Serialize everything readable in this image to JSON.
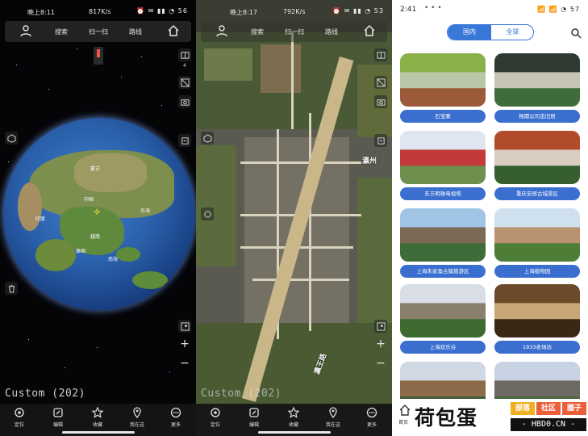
{
  "panel1": {
    "status": {
      "time": "晚上8:11",
      "net": "817K/s",
      "battery_icons": "⏰ ✉ ▮▮ ◔ 56"
    },
    "topbar": {
      "search": "搜索",
      "scan": "扫一扫",
      "route": "路线"
    },
    "side": {
      "layer_count": "4"
    },
    "custom_label": "Custom (202)",
    "globe_labels": [
      "蒙古",
      "中国",
      "东海",
      "南海",
      "越南",
      "泰国",
      "印度"
    ],
    "bottom": [
      "定位",
      "编辑",
      "收藏",
      "我在这",
      "更多"
    ]
  },
  "panel2": {
    "status": {
      "time": "晚上8:17",
      "net": "792K/s",
      "battery_icons": "⏰ ✉ ▮▮ ◔ 53"
    },
    "topbar": {
      "search": "搜索",
      "scan": "扫一扫",
      "route": "路线"
    },
    "custom_label": "Custom (202)",
    "road_labels": [
      "瀛州",
      "瀛王路"
    ],
    "bottom": [
      "定位",
      "编辑",
      "收藏",
      "我在这",
      "更多"
    ]
  },
  "panel3": {
    "status": {
      "time": "2:41",
      "dots": "• • •",
      "battery_icons": "📶 📶 ◔ 57"
    },
    "tabs": {
      "domestic": "国内",
      "global": "全球"
    },
    "cards": [
      {
        "caption": "石宝寨",
        "colors": [
          "#8ab04a",
          "#b7c7a8",
          "#9b5b3a"
        ]
      },
      {
        "caption": "杨闇公司志旧居",
        "colors": [
          "#2e3a32",
          "#c8c4b3",
          "#3f6d3a"
        ]
      },
      {
        "caption": "东方明珠电视塔",
        "colors": [
          "#dfe6ef",
          "#c43a3a",
          "#6e8f4e"
        ]
      },
      {
        "caption": "重庆安居古城景区",
        "colors": [
          "#b24a2c",
          "#d9cdbf",
          "#375e2e"
        ]
      },
      {
        "caption": "上海朱家角古镇旅游区",
        "colors": [
          "#9fc4e6",
          "#7b6a55",
          "#3f6d3a"
        ]
      },
      {
        "caption": "上海植物园",
        "colors": [
          "#cfe0ef",
          "#b99270",
          "#4d7d36"
        ]
      },
      {
        "caption": "上海欢乐谷",
        "colors": [
          "#d8dde6",
          "#8a7f6c",
          "#3c6a2f"
        ]
      },
      {
        "caption": "1933老场坊",
        "colors": [
          "#6b4a2a",
          "#c9a676",
          "#3a2716"
        ]
      },
      {
        "caption": "",
        "colors": [
          "#cfd8e3",
          "#8d6a4a",
          "#3a5b35"
        ]
      },
      {
        "caption": "",
        "colors": [
          "#c7d3e2",
          "#6d6a63",
          "#49663a"
        ]
      }
    ]
  },
  "watermark": {
    "brand": "荷包蛋",
    "tags": [
      "部落",
      "社区",
      "圈子"
    ],
    "url": "- HBD0.CN -",
    "home_label": "首页"
  },
  "colors": {
    "accent": "#3a78d8",
    "caption_bg": "#3a6fd0",
    "tag1": "#f0b022",
    "tag2": "#e9603a",
    "tag3": "#e9603a"
  }
}
